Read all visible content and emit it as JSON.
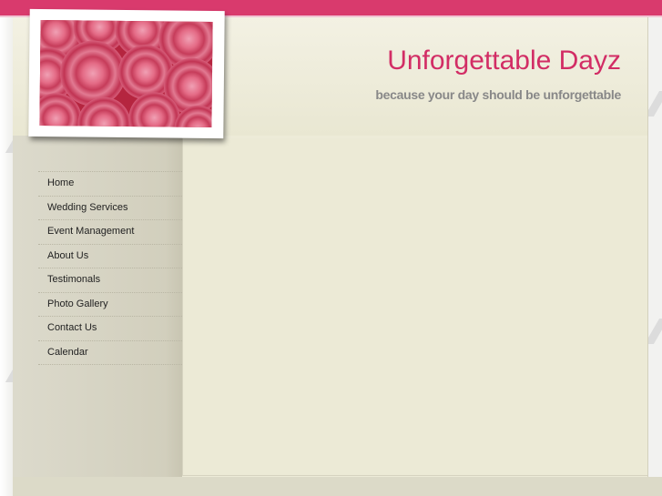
{
  "site": {
    "title": "Unforgettable Dayz",
    "tagline": "because your day should be unforgettable"
  },
  "header_image": {
    "icon": "roses-photo",
    "description_colors": [
      "#b5253f",
      "#e46b86",
      "#f0a0b4"
    ]
  },
  "nav": {
    "items": [
      {
        "label": "Home"
      },
      {
        "label": "Wedding Services"
      },
      {
        "label": "Event Management"
      },
      {
        "label": "About Us"
      },
      {
        "label": "Testimonals"
      },
      {
        "label": "Photo Gallery"
      },
      {
        "label": "Contact Us"
      },
      {
        "label": "Calendar"
      }
    ]
  },
  "colors": {
    "accent": "#d93a6d",
    "title": "#d22d65",
    "tagline": "#888888",
    "page_bg": "#edebd8",
    "sidebar_bg": "#d2cfbd"
  }
}
